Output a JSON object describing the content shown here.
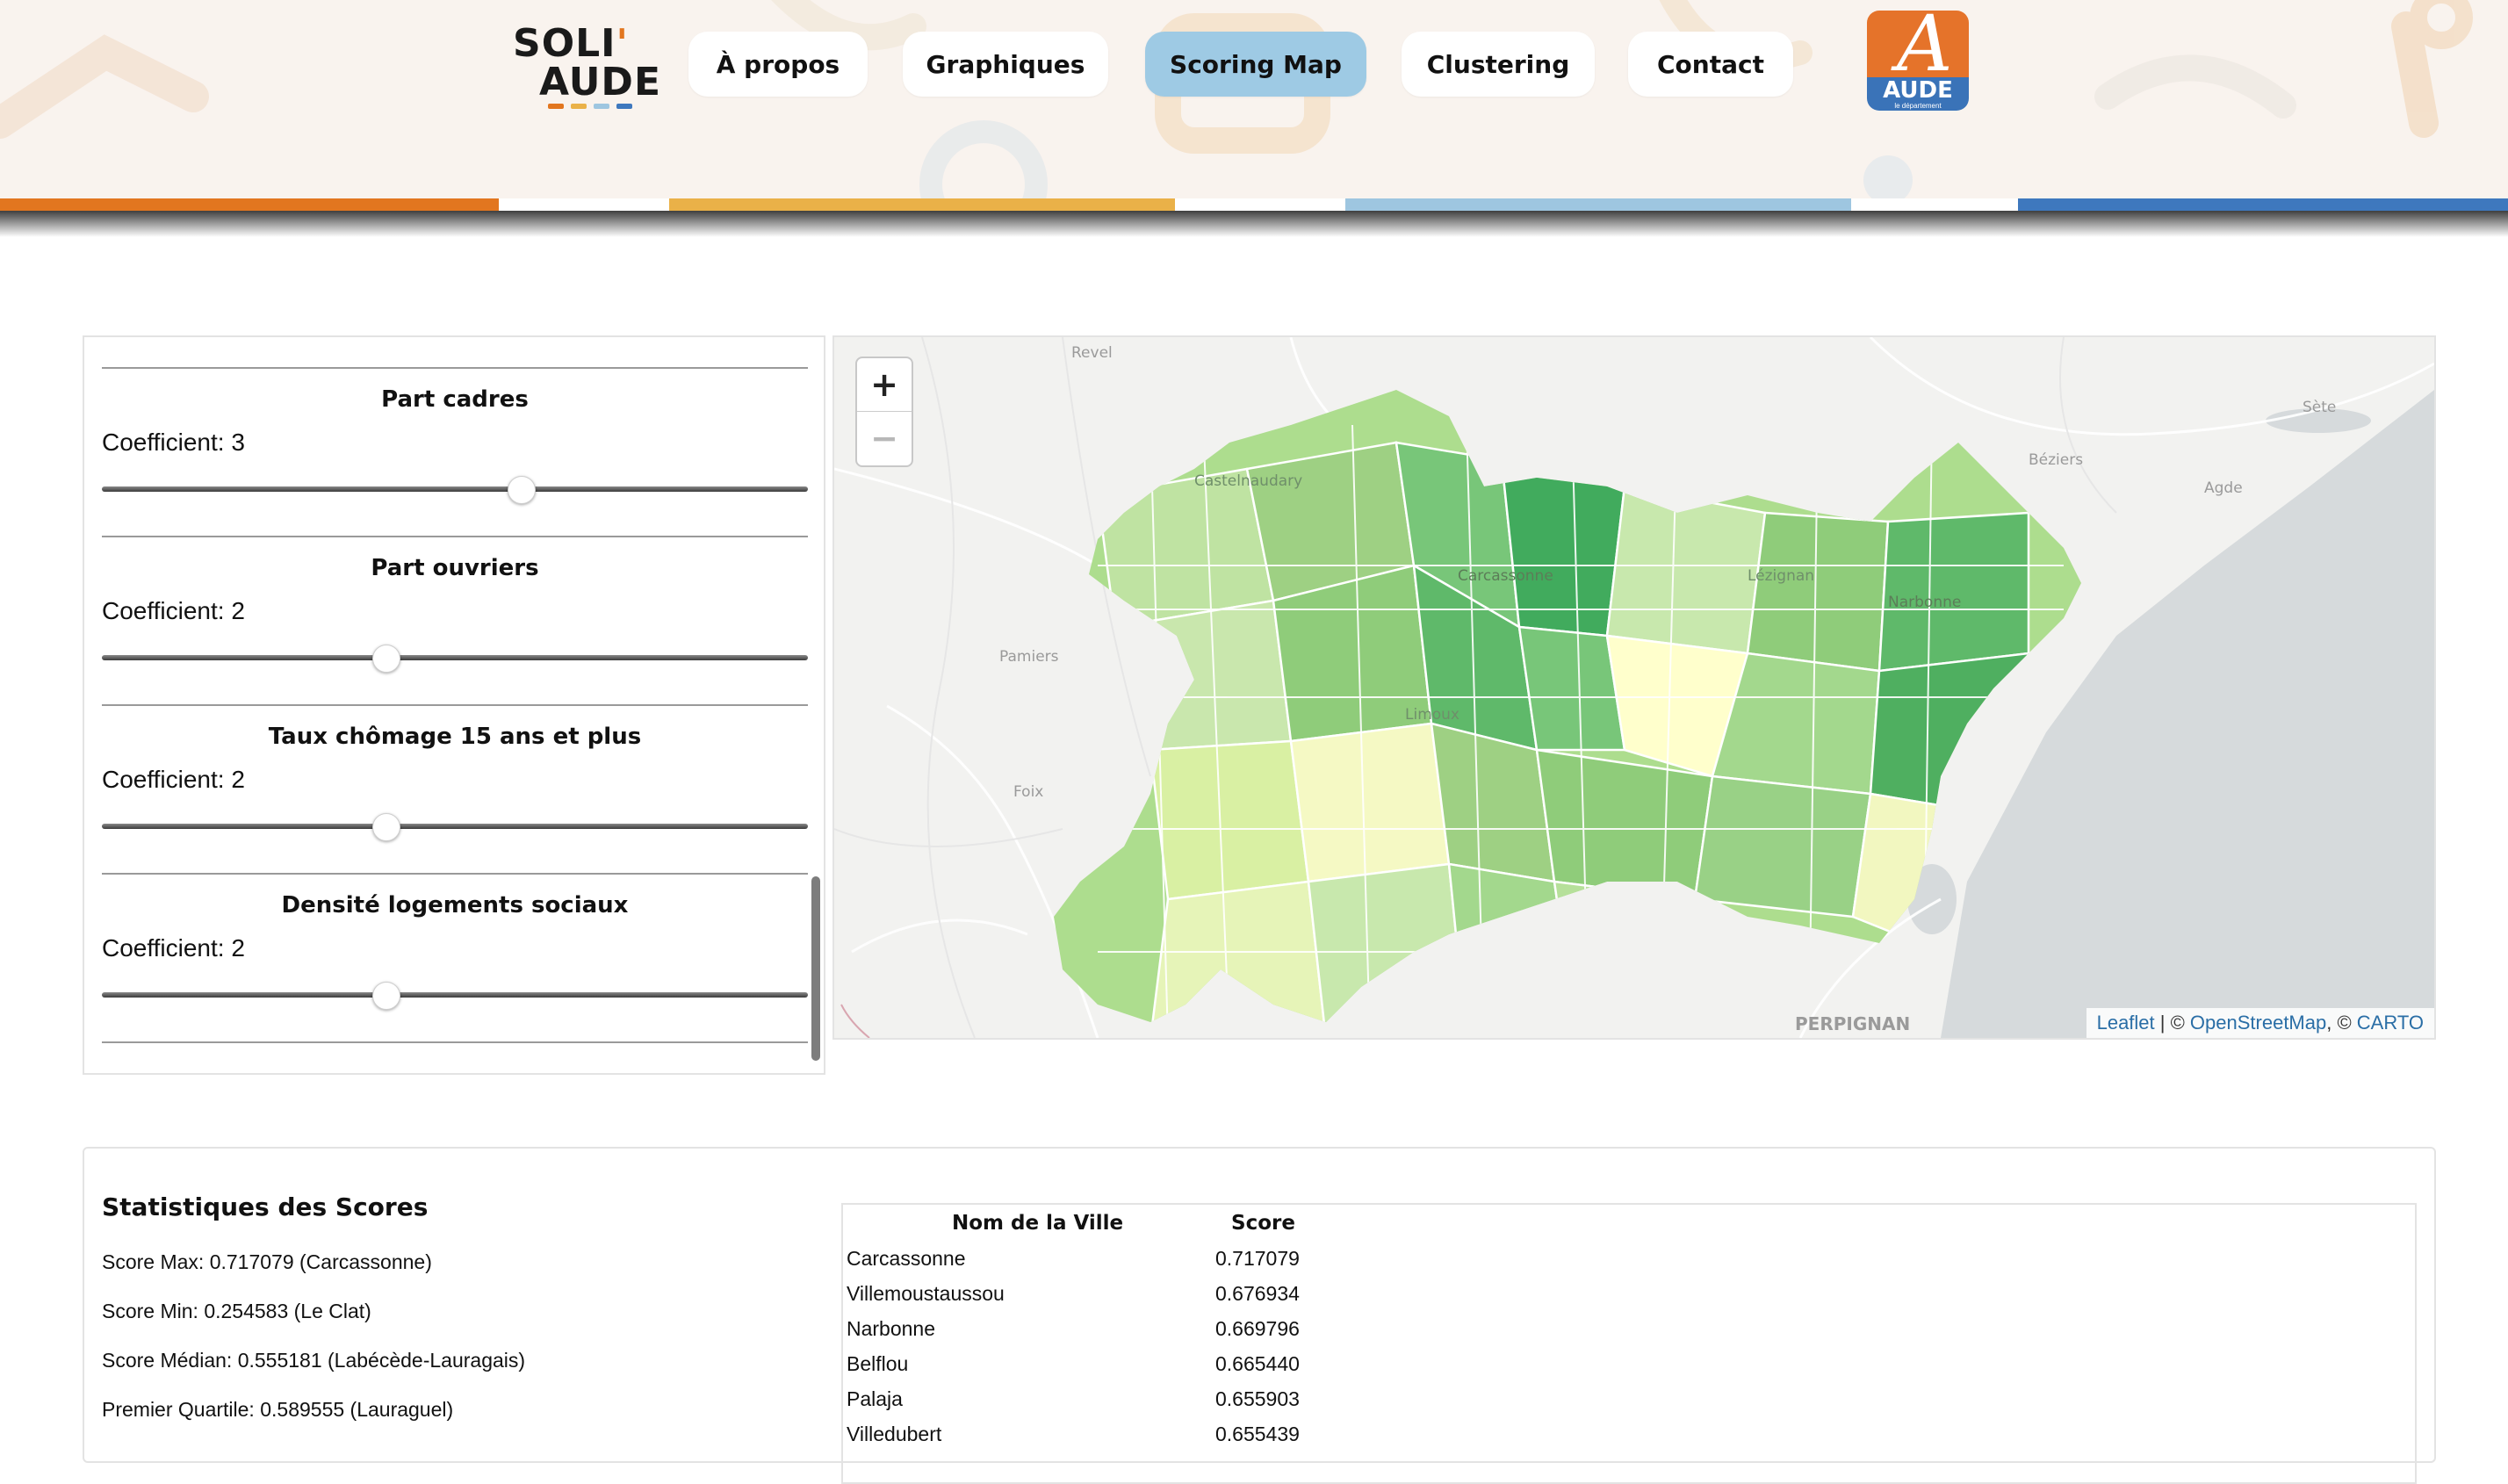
{
  "header": {
    "logo": {
      "line1": "SOLI",
      "apostrophe": "'",
      "line2": "AUDE"
    },
    "nav": [
      {
        "label": "À propos",
        "active": false
      },
      {
        "label": "Graphiques",
        "active": false
      },
      {
        "label": "Scoring Map",
        "active": true
      },
      {
        "label": "Clustering",
        "active": false
      },
      {
        "label": "Contact",
        "active": false
      }
    ],
    "department_logo": {
      "word": "AUDE",
      "subtitle": "le département"
    },
    "colors": {
      "orange": "#e2761f",
      "yellow": "#eab148",
      "light_blue": "#9ec6e0",
      "blue": "#3e78be",
      "active_nav": "#9ecae4"
    }
  },
  "sliders": [
    {
      "title": "Part cadres",
      "coefficient": "Coefficient: 3",
      "value": 3
    },
    {
      "title": "Part ouvriers",
      "coefficient": "Coefficient: 2",
      "value": 2
    },
    {
      "title": "Taux chômage 15 ans et plus",
      "coefficient": "Coefficient: 2",
      "value": 2
    },
    {
      "title": "Densité logements sociaux",
      "coefficient": "Coefficient: 2",
      "value": 2
    }
  ],
  "map": {
    "zoom_in": "+",
    "zoom_out": "−",
    "attribution": {
      "leaflet": "Leaflet",
      "sep1": " | © ",
      "osm": "OpenStreetMap",
      "sep2": ", © ",
      "carto": "CARTO"
    },
    "places": [
      "Revel",
      "Castelnaudary",
      "Carcassonne",
      "Lézignan",
      "Narbonne",
      "Limoux",
      "Béziers",
      "Agde",
      "Sète",
      "Pamiers",
      "Foix",
      "PERPIGNAN"
    ],
    "choropleth_colors": [
      "#ffffcc",
      "#d9f0a3",
      "#addd8e",
      "#78c679",
      "#41ab5d"
    ]
  },
  "stats": {
    "title": "Statistiques des Scores",
    "lines": [
      "Score Max: 0.717079 (Carcassonne)",
      "Score Min: 0.254583 (Le Clat)",
      "Score Médian: 0.555181 (Labécède-Lauragais)",
      "Premier Quartile: 0.589555 (Lauraguel)"
    ],
    "table": {
      "headers": [
        "Nom de la Ville",
        "Score"
      ],
      "rows": [
        [
          "Carcassonne",
          "0.717079"
        ],
        [
          "Villemoustaussou",
          "0.676934"
        ],
        [
          "Narbonne",
          "0.669796"
        ],
        [
          "Belflou",
          "0.665440"
        ],
        [
          "Palaja",
          "0.655903"
        ],
        [
          "Villedubert",
          "0.655439"
        ]
      ]
    }
  }
}
